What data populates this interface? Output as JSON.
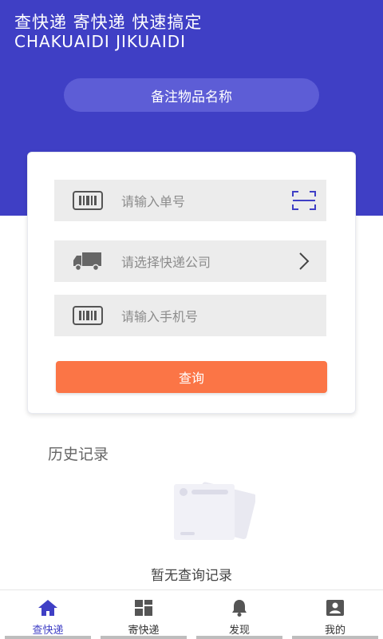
{
  "header": {
    "slogan": "查快递  寄快递  快速搞定",
    "slogan_en": "CHAKUAIDI  JIKUAIDI",
    "remark_button": "备注物品名称"
  },
  "form": {
    "tracking_placeholder": "请输入单号",
    "company_placeholder": "请选择快递公司",
    "phone_placeholder": "请输入手机号",
    "query_button": "查询"
  },
  "history": {
    "title": "历史记录",
    "empty_text": "暂无查询记录"
  },
  "tabs": [
    {
      "label": "查快递",
      "icon": "home-icon",
      "active": true
    },
    {
      "label": "寄快递",
      "icon": "grid-icon",
      "active": false
    },
    {
      "label": "发现",
      "icon": "bell-icon",
      "active": false
    },
    {
      "label": "我的",
      "icon": "profile-icon",
      "active": false
    }
  ],
  "colors": {
    "primary": "#3f3fc5",
    "accent": "#fb7546",
    "field_bg": "#ececec"
  }
}
